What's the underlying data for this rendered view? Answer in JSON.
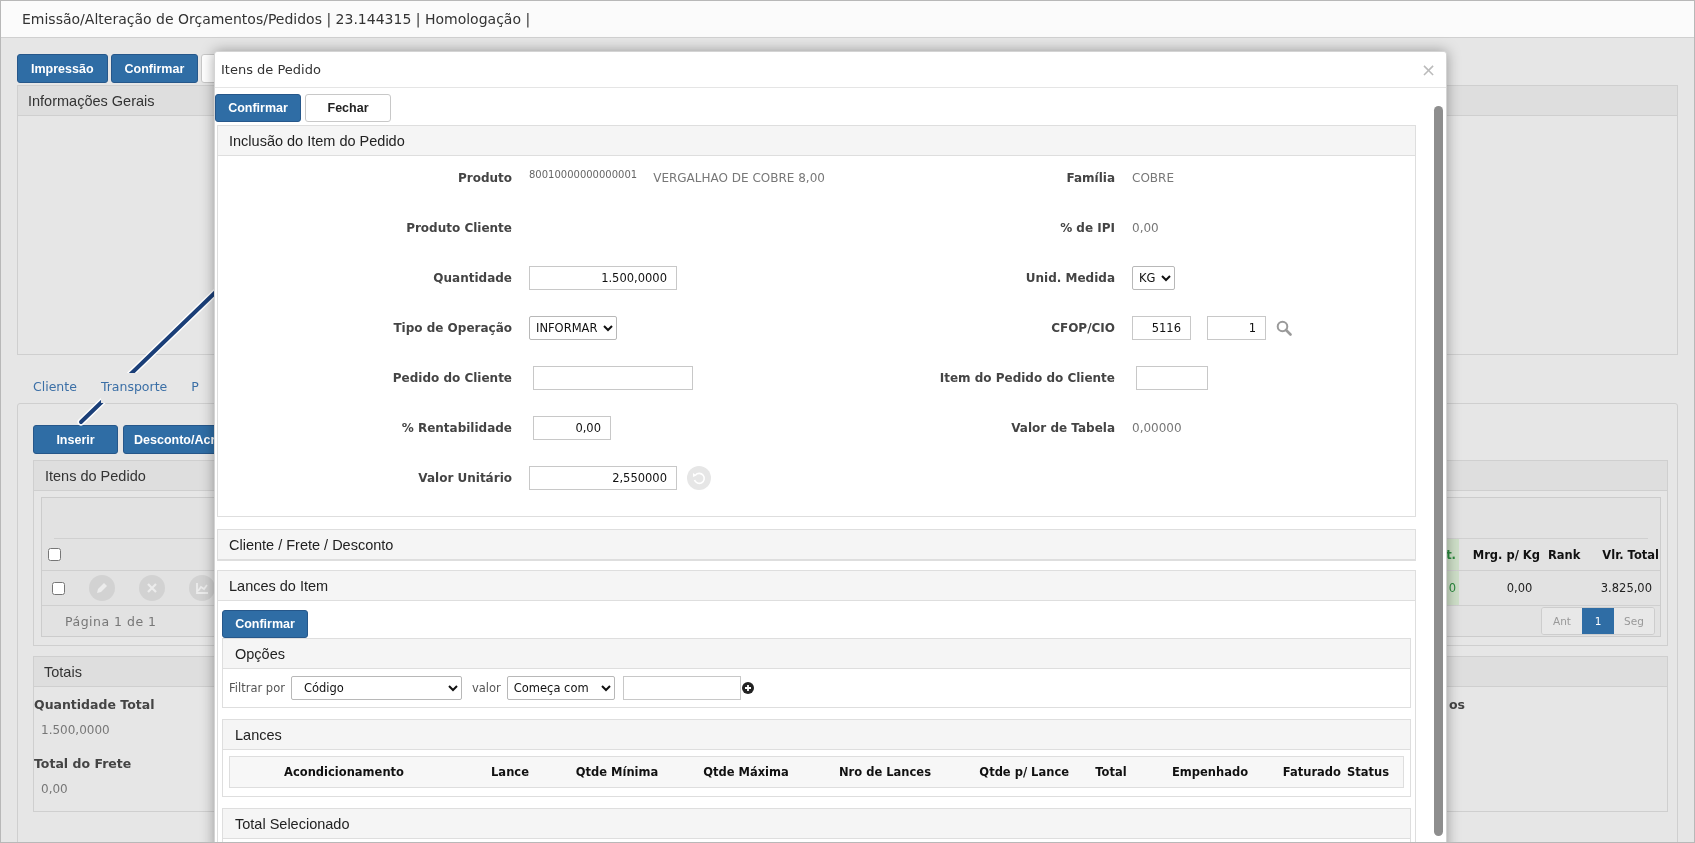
{
  "page": {
    "title": "Emissão/Alteração de Orçamentos/Pedidos | 23.144315 | Homologação |"
  },
  "toolbar_buttons": [
    {
      "label": "Impressão",
      "kind": "primary"
    },
    {
      "label": "Confirmar",
      "kind": "primary"
    },
    {
      "kind": "default"
    }
  ],
  "general_info": {
    "title": "Informações Gerais"
  },
  "tabs": [
    {
      "label": "Cliente",
      "selected": false
    },
    {
      "label": "Transporte",
      "selected": false
    },
    {
      "label": "P",
      "selected": false
    }
  ],
  "item_buttons": [
    "Inserir",
    "Desconto/Acr"
  ],
  "items_panel": {
    "title": "Itens do Pedido",
    "header_checked": false,
    "columns": [
      {
        "label": "t.",
        "kind": "highlight"
      },
      {
        "label": "Mrg. p/ Kg",
        "kind": "plain"
      },
      {
        "label": "Rank",
        "kind": "plain"
      },
      {
        "label": "Vlr. Total",
        "kind": "plain"
      }
    ],
    "rows": [
      {
        "checked": false,
        "cells": [
          "0",
          "0,00",
          null,
          "3.825,00"
        ]
      }
    ],
    "page_info": "Página 1 de 1",
    "pagination": [
      {
        "label": "Ant",
        "selected": false
      },
      {
        "label": "1",
        "selected": true
      },
      {
        "label": "Seg",
        "selected": false
      }
    ]
  },
  "totals": {
    "title": "Totais",
    "fields": [
      {
        "label": "Quantidade Total",
        "value": "1.500,0000"
      },
      {
        "label": "Total do Frete",
        "value": "0,00"
      }
    ],
    "column_2_label": "os"
  },
  "modal": {
    "title": "Itens de Pedido",
    "close": "×",
    "buttons": [
      {
        "label": "Confirmar",
        "kind": "primary"
      },
      {
        "label": "Fechar",
        "kind": "default"
      }
    ],
    "item_section": {
      "title": "Inclusão do Item do Pedido",
      "rows": [
        {
          "left": {
            "label": "Produto",
            "kind": "text",
            "values": [
              "80010000000000001",
              "VERGALHAO DE COBRE 8,00"
            ]
          },
          "right": {
            "label": "Família",
            "kind": "text",
            "values": [
              "COBRE"
            ]
          }
        },
        {
          "left": {
            "label": "Produto Cliente",
            "kind": "text"
          },
          "right": {
            "label": "% de IPI",
            "kind": "text",
            "values": [
              "0,00"
            ]
          }
        },
        {
          "left": {
            "label": "Quantidade",
            "kind": "input",
            "values": [
              "1.500,0000"
            ]
          },
          "right": {
            "label": "Unid. Medida",
            "kind": "select",
            "values": [
              "KG"
            ]
          }
        },
        {
          "left": {
            "label": "Tipo de Operação",
            "kind": "select",
            "values": [
              "INFORMAR"
            ]
          },
          "right": {
            "label": "CFOP/CIO",
            "kind": "lookup",
            "values": [
              "5116",
              "1"
            ]
          }
        },
        {
          "left": {
            "label": "Pedido do Cliente",
            "kind": "input"
          },
          "right": {
            "label": "Item do Pedido do Cliente",
            "kind": "input"
          }
        },
        {
          "left": {
            "label": "% Rentabilidade",
            "kind": "input",
            "values": [
              "0,00"
            ]
          },
          "right": {
            "label": "Valor de Tabela",
            "kind": "text",
            "values": [
              "0,00000"
            ]
          }
        },
        {
          "left": {
            "label": "Valor Unitário",
            "kind": "input_reset",
            "values": [
              "2,550000"
            ]
          }
        }
      ]
    },
    "freight_section": {
      "title": "Cliente / Frete / Desconto"
    },
    "bids_section": {
      "title": "Lances do Item",
      "button": "Confirmar",
      "options": {
        "title": "Opções",
        "filter_label": "Filtrar por",
        "filter_value": "Código",
        "value_label": "valor",
        "match_value": "Começa com"
      },
      "bids": {
        "title": "Lances",
        "columns": [
          "Acondicionamento",
          "Lance",
          "Qtde Mínima",
          "Qtde Máxima",
          "Nro de Lances",
          "Qtde p/ Lance",
          "Total",
          "Empenhado",
          "Faturado",
          "Status"
        ]
      },
      "total_selected": {
        "title": "Total Selecionado"
      }
    }
  }
}
